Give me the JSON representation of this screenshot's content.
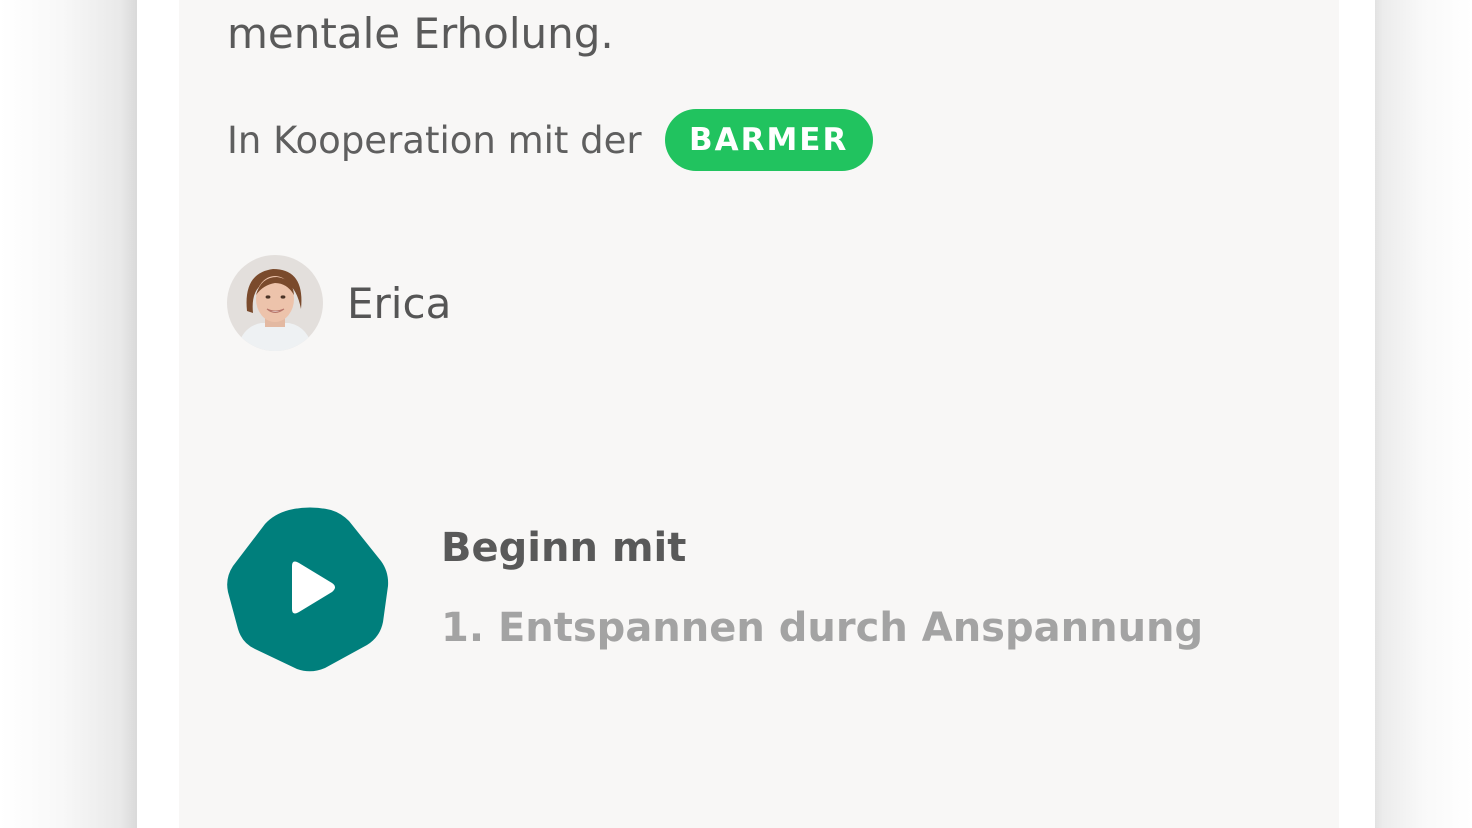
{
  "course": {
    "description_tail": "mentale Erholung.",
    "cooperation": {
      "label": "In Kooperation mit der",
      "partner": "BARMER"
    },
    "author": {
      "name": "Erica"
    }
  },
  "session": {
    "heading": "Beginn mit",
    "title": "1. Entspannen durch Anspannung"
  },
  "colors": {
    "accent": "#007f7c",
    "partner_badge": "#21c35f",
    "card_background": "#f8f7f6"
  },
  "icons": {
    "play": "play-icon",
    "avatar": "author-avatar"
  }
}
